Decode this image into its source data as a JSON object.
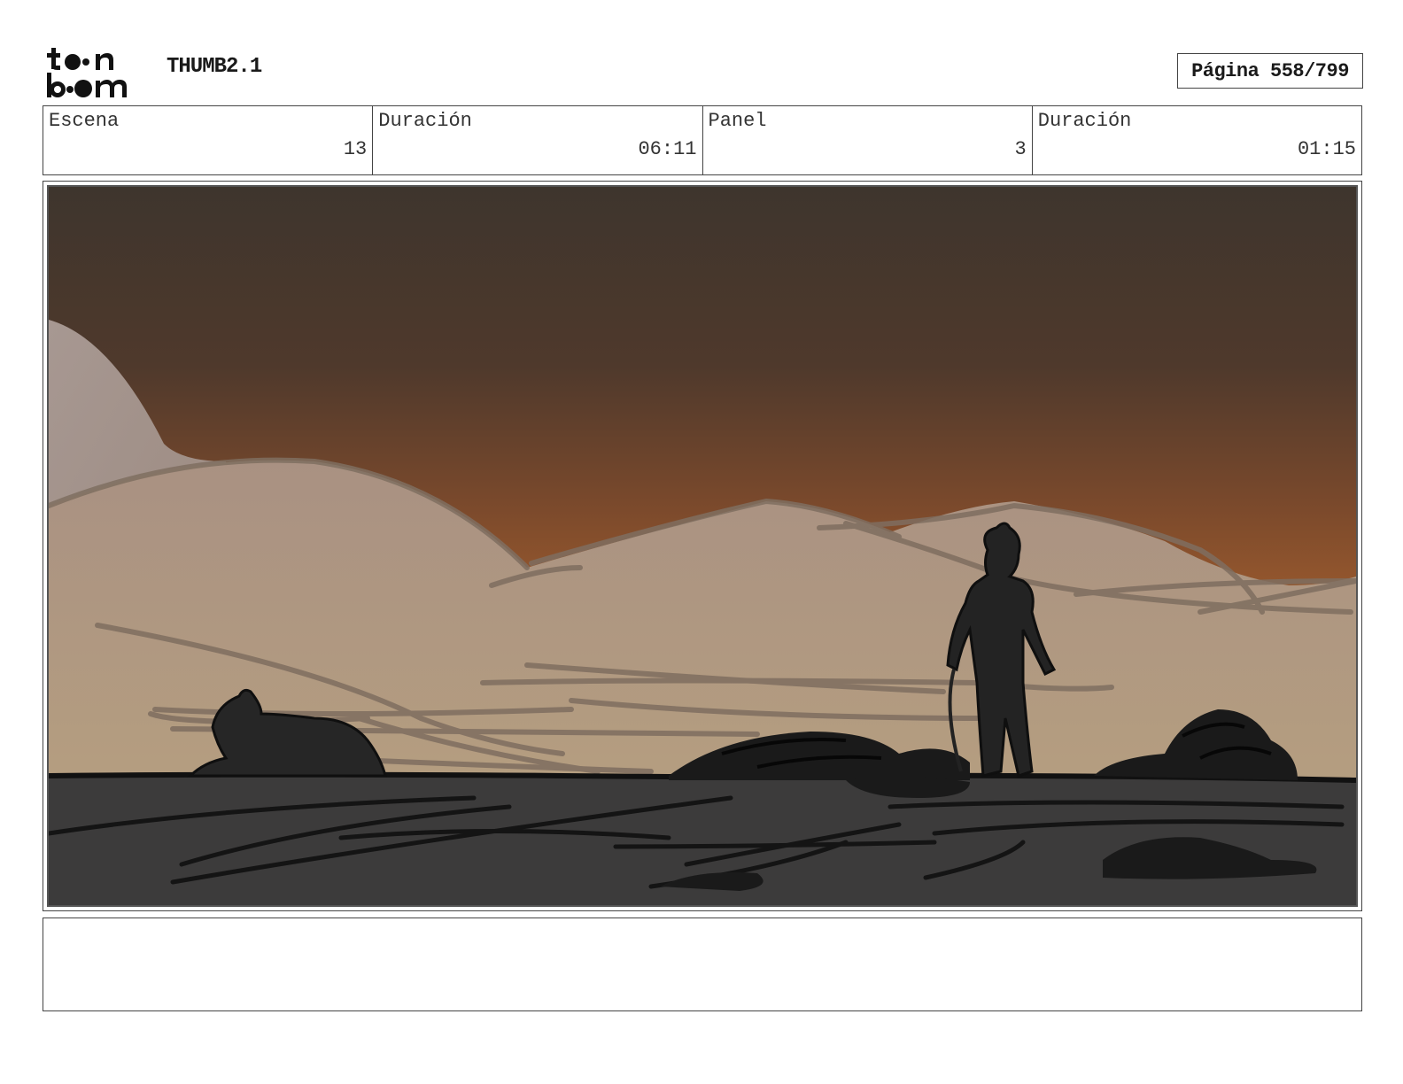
{
  "header": {
    "logo": {
      "line1": "toon",
      "line2": "boom",
      "icon": "toon-boom-logo"
    },
    "project_title": "THUMB2.1",
    "page_label": "Página 558/799"
  },
  "info": [
    {
      "label": "Escena",
      "value": "13"
    },
    {
      "label": "Duración",
      "value": "06:11"
    },
    {
      "label": "Panel",
      "value": "3"
    },
    {
      "label": "Duración",
      "value": "01:15"
    }
  ],
  "panel": {
    "sky_colors": [
      "#3e352d",
      "#6a3e2a",
      "#a85f2c"
    ],
    "ground_color": "#3b3a3a",
    "hill_color": "#b39c82",
    "near_hill_color": "#a68770"
  },
  "notes": {
    "text": ""
  }
}
